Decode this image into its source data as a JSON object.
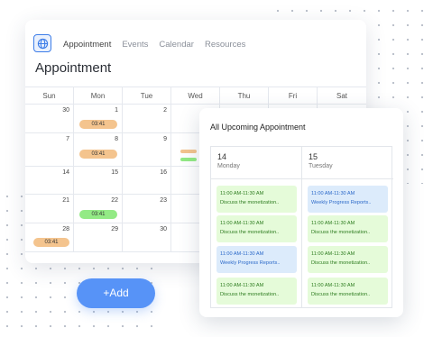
{
  "header": {
    "tabs": [
      "Appointment",
      "Events",
      "Calendar",
      "Resources"
    ],
    "title": "Appointment"
  },
  "calendar": {
    "weekdays": [
      "Sun",
      "Mon",
      "Tue",
      "Wed",
      "Thu",
      "Fri",
      "Sat"
    ],
    "weeks": [
      [
        "30",
        "1",
        "2",
        "",
        "",
        "",
        ""
      ],
      [
        "7",
        "8",
        "9",
        "",
        "",
        "",
        ""
      ],
      [
        "14",
        "15",
        "16",
        "",
        "",
        "",
        ""
      ],
      [
        "21",
        "22",
        "23",
        "",
        "",
        "",
        ""
      ],
      [
        "28",
        "29",
        "30",
        "",
        "",
        "",
        ""
      ]
    ],
    "events": {
      "mon_1": "03:41",
      "mon_8": "03:41",
      "mon_22": "03:41",
      "sun_28": "03:41"
    },
    "colors": {
      "orange": "#f4c48e",
      "green": "#93ea85"
    }
  },
  "upcoming": {
    "title": "All Upcoming Appointment",
    "columns": [
      {
        "day": "14",
        "weekday": "Monday",
        "events": [
          {
            "time": "11:00 AM-11:30 AM",
            "text": "Discuss the monetization..",
            "color": "green"
          },
          {
            "time": "11:00 AM-11:30 AM",
            "text": "Discuss the monetization..",
            "color": "green"
          },
          {
            "time": "11:00 AM-11:30 AM",
            "text": "Weekly Progress Reports..",
            "color": "blue"
          },
          {
            "time": "11:00 AM-11:30 AM",
            "text": "Discuss the monetization..",
            "color": "green"
          }
        ]
      },
      {
        "day": "15",
        "weekday": "Tuesday",
        "events": [
          {
            "time": "11:00 AM-11:30 AM",
            "text": "Weekly Progress Reports..",
            "color": "blue"
          },
          {
            "time": "11:00 AM-11:30 AM",
            "text": "Discuss the monetization..",
            "color": "green"
          },
          {
            "time": "11:00 AM-11:30 AM",
            "text": "Discuss the monetization..",
            "color": "green"
          },
          {
            "time": "11:00 AM-11:30 AM",
            "text": "Discuss the monetization..",
            "color": "green"
          }
        ]
      }
    ]
  },
  "add_button": {
    "label": "+Add"
  }
}
